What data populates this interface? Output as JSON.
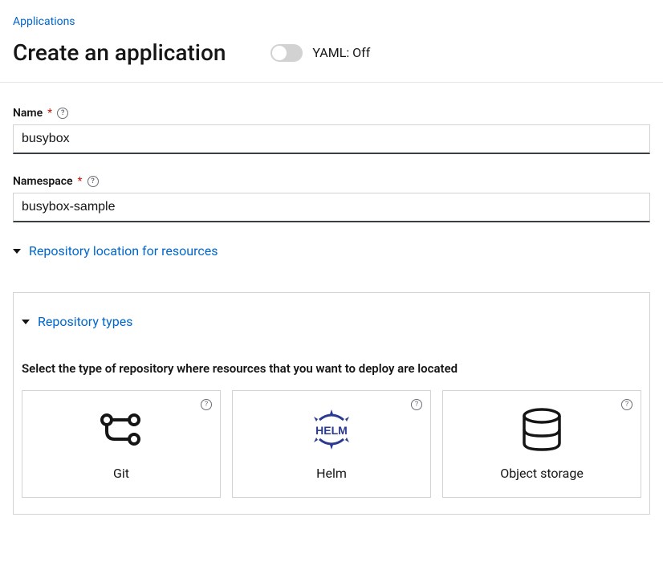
{
  "breadcrumb": {
    "applications": "Applications"
  },
  "header": {
    "title": "Create an application",
    "yaml_label": "YAML: Off"
  },
  "form": {
    "name": {
      "label": "Name",
      "value": "busybox"
    },
    "namespace": {
      "label": "Namespace",
      "value": "busybox-sample"
    }
  },
  "sections": {
    "repo_location": "Repository location for resources",
    "repo_types": "Repository types",
    "repo_select_text": "Select the type of repository where resources that you want to deploy are located"
  },
  "cards": {
    "git": "Git",
    "helm": "Helm",
    "object_storage": "Object storage"
  }
}
